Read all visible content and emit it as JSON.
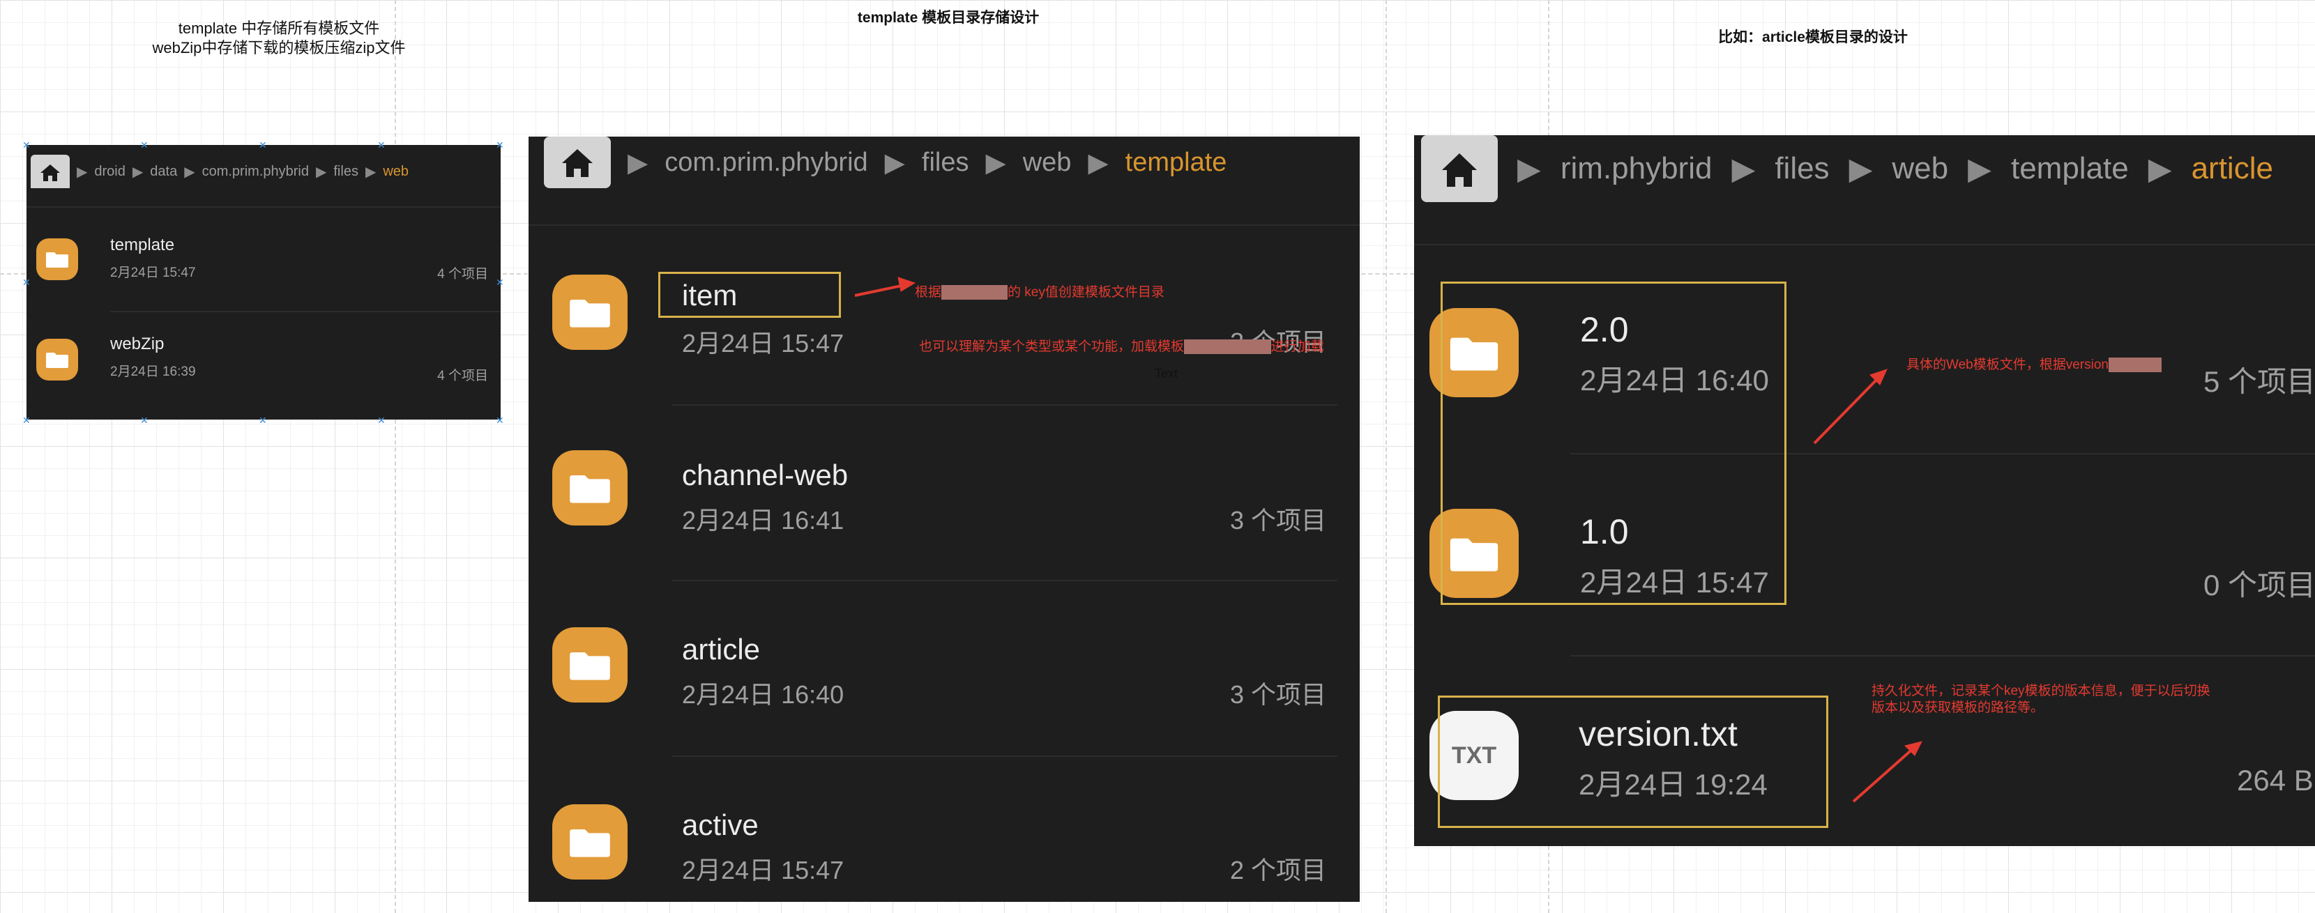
{
  "captions": {
    "left_line1": "template 中存储所有模板文件",
    "left_line2": "webZip中存储下载的模板压缩zip文件",
    "middle": "template 模板目录存储设计",
    "right": "比如：article模板目录的设计"
  },
  "panel_small": {
    "breadcrumb": [
      "droid",
      "data",
      "com.prim.phybrid",
      "files"
    ],
    "breadcrumb_active": "web",
    "items": [
      {
        "name": "template",
        "date": "2月24日 15:47",
        "count": "4 个项目"
      },
      {
        "name": "webZip",
        "date": "2月24日 16:39",
        "count": "4 个项目"
      }
    ]
  },
  "panel_template": {
    "breadcrumb": [
      "com.prim.phybrid",
      "files",
      "web"
    ],
    "breadcrumb_active": "template",
    "items": [
      {
        "name": "item",
        "date": "2月24日 15:47",
        "count": "2 个项目"
      },
      {
        "name": "channel-web",
        "date": "2月24日 16:41",
        "count": "3 个项目"
      },
      {
        "name": "article",
        "date": "2月24日 16:40",
        "count": "3 个项目"
      },
      {
        "name": "active",
        "date": "2月24日 15:47",
        "count": "2 个项目"
      }
    ],
    "notes": {
      "note1_pre": "根据",
      "note1_blur": "服务端返回",
      "note1_post": "的 key值创建模板文件目录",
      "note2_pre": "也可以理解为某个类型或某个功能，加载模板",
      "note2_blur": "时根据这个key",
      "note2_post": "进行加载",
      "text_label": "Text"
    }
  },
  "panel_article": {
    "breadcrumb": [
      "rim.phybrid",
      "files",
      "web",
      "template"
    ],
    "breadcrumb_active": "article",
    "items": [
      {
        "name": "2.0",
        "date": "2月24日 16:40",
        "count": "5 个项目"
      },
      {
        "name": "1.0",
        "date": "2月24日 15:47",
        "count": "0 个项目"
      },
      {
        "name": "version.txt",
        "date": "2月24日 19:24",
        "count": "264 B",
        "icon_label": "TXT"
      }
    ],
    "notes": {
      "note1_pre": "具体的Web模板文件，根据version",
      "note1_blur": "创建目录",
      "note2_line1": "持久化文件，记录某个key模板的版本信息，便于以后切换",
      "note2_line2": "版本以及获取模板的路径等。"
    }
  },
  "colors": {
    "panel_bg": "#1e1e1e",
    "folder": "#e29c3a",
    "breadcrumb_active": "#d9952f",
    "highlight_box": "#d8b24a",
    "annotation": "#e43a30"
  }
}
